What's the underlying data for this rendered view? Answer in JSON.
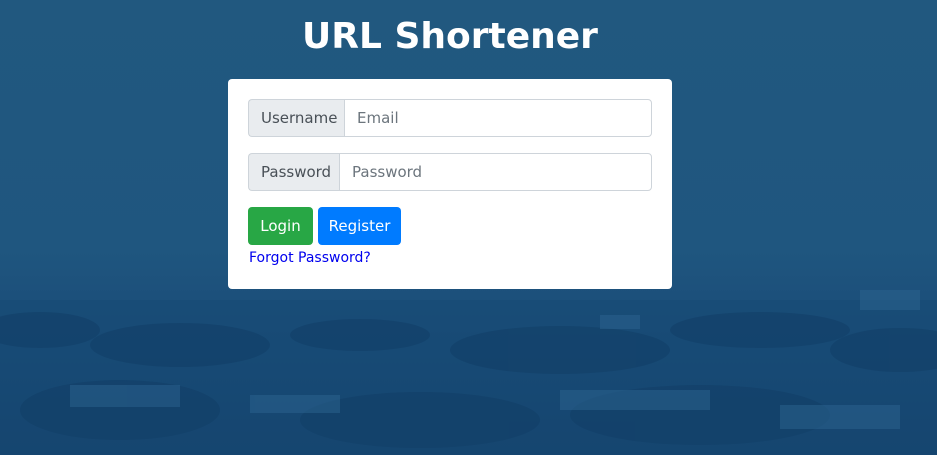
{
  "page": {
    "title": "URL Shortener"
  },
  "login_form": {
    "username_label": "Username",
    "username_placeholder": "Email",
    "password_label": "Password",
    "password_placeholder": "Password",
    "login_button": "Login",
    "register_button": "Register",
    "forgot_password_link": "Forgot Password?"
  },
  "colors": {
    "background": "#1f5682",
    "login_button": "#28a745",
    "register_button": "#007bff",
    "link": "#0000ee"
  }
}
